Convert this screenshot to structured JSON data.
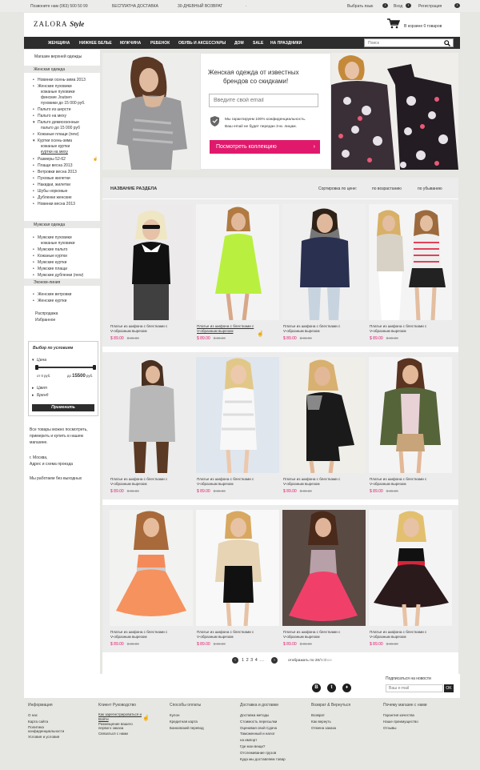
{
  "topbar": {
    "phone": "Позвоните нам (063) 500 50 99",
    "delivery": "БЕСПЛАТНА ДОСТАВКА",
    "return": "30-ДНЕВНЫЙ ВОЗВРАТ",
    "dot": "·",
    "lang": "Выбрать язык",
    "login": "Вход",
    "register": "Регистрация"
  },
  "header": {
    "logo_main": "ZALORA",
    "logo_style": "Style",
    "cart_text": "В корзине 0 товаров"
  },
  "nav": {
    "items": [
      "ЖЕНЩИНА",
      "НИЖНЕЕ БЕЛЬЕ",
      "МУЖЧИНА",
      "РЕБЕНОК",
      "ОБУВЬ И АКСЕССУАРЫ",
      "ДОМ",
      "SALE",
      "НА ПРАЗДНИКИ"
    ],
    "search_placeholder": "Поиск"
  },
  "sidebar": {
    "top_link": "Магазин верхней одежды",
    "women_head": "Женская одежда",
    "women_items": [
      "Новинки осень-зима 2013",
      "Женские пуховики",
      "кожаные пуховики",
      "финские Joutsen",
      "пуховики до 15 000 руб.",
      "Пальто из шерсти",
      "Пальто на меху",
      "Пальто демисезонные",
      "пальто до 15 000 руб",
      "Кожаные плащи (new)",
      "Куртки осень-зима",
      "кожаные куртки",
      "куртки на меху",
      "Размеры 52-62",
      "Плащи весна 2013",
      "Ветровки весна 2013",
      "Пуховые жилетки",
      "Накидки, жилетки",
      "Шубы норковые",
      "Дубленки женские",
      "Новинки весна 2013"
    ],
    "men_head": "Мужская одежда",
    "men_items": [
      "Мужские пуховики",
      "кожаные пуховики",
      "Мужские пальто",
      "Кожаные куртки",
      "Мужские куртки",
      "Мужские плащи",
      "Мужские дубленки (new)"
    ],
    "econom_head": "Эконом-линия",
    "econom_items": [
      "Женские ветровки",
      "Женские куртки"
    ],
    "extra_links": [
      "Распродажа",
      "Избранное"
    ],
    "filter_title": "Выбор по условиям",
    "filter_price": "Цена",
    "filter_from": "от 0",
    "filter_from_unit": "руб.",
    "filter_to": "до",
    "filter_to_value": "15500",
    "filter_to_unit": "руб.",
    "filter_color": "Цвет",
    "filter_brand": "Бренд",
    "filter_apply": "Применить",
    "info_text_1": "Все товары можно посмотреть,",
    "info_text_2": "примерить и купить в нашем",
    "info_text_3": "магазине.",
    "address_1": "г. Москва,",
    "address_2": "Адрес и схема проезда",
    "hours": "Мы работаем без выходных"
  },
  "banner": {
    "headline_1": "Женская  одежда от известных",
    "headline_2": "брендов со скидками!",
    "email_placeholder": "Введите свой email",
    "privacy_1": "Мы гарантируем 100% конфиденциальность.",
    "privacy_2": "Ваш email не будет передан 3-м. лицам.",
    "cta": "Посмотреть коллекцию"
  },
  "section": {
    "title": "НАЗВАНИЕ РАЗДЕЛА",
    "sort_label": "Сортировка по цене:",
    "sort_asc": "по возрастанию",
    "sort_desc": "по убыванию"
  },
  "products": [
    {
      "desc1": "Платье из шифона с блестками с",
      "desc2": "V-образным вырезом",
      "price": "$ 89.00",
      "old": "$ 89.00"
    },
    {
      "desc1": "Платье из шифона с блестками с",
      "desc2": "V-образным вырезом",
      "price": "$ 89.00",
      "old": "$ 89.00"
    },
    {
      "desc1": "Платье из шифона с блестками с",
      "desc2": "V-образным вырезом",
      "price": "$ 89.00",
      "old": "$ 89.00"
    },
    {
      "desc1": "Платье из шифона с блестками с",
      "desc2": "V-образным вырезом",
      "price": "$ 89.00",
      "old": "$ 89.00"
    },
    {
      "desc1": "Платье из шифона с блестками с",
      "desc2": "V-образным вырезом",
      "price": "$ 89.00",
      "old": "$ 89.00"
    },
    {
      "desc1": "Платье из шифона с блестками с",
      "desc2": "V-образным вырезом",
      "price": "$ 89.00",
      "old": "$ 89.00"
    },
    {
      "desc1": "Платье из шифона с блестками с",
      "desc2": "V-образным вырезом",
      "price": "$ 89.00",
      "old": "$ 89.00"
    },
    {
      "desc1": "Платье из шифона с блестками с",
      "desc2": "V-образным вырезом",
      "price": "$ 89.00",
      "old": "$ 89.00"
    },
    {
      "desc1": "Платье из шифона с блестками с",
      "desc2": "V-образным вырезом",
      "price": "$ 89.00",
      "old": "$ 89.00"
    },
    {
      "desc1": "Платье из шифона с блестками с",
      "desc2": "V-образным вырезом",
      "price": "$ 89.00",
      "old": "$ 89.00"
    },
    {
      "desc1": "Платье из шифона с блестками с",
      "desc2": "V-образным вырезом",
      "price": "$ 89.00",
      "old": "$ 89.00"
    },
    {
      "desc1": "Платье из шифона с блестками с",
      "desc2": "V-образным вырезом",
      "price": "$ 89.00",
      "old": "$ 89.00"
    }
  ],
  "pagination": {
    "pages": "1 2 3 4 ...",
    "show_label": "отображать по",
    "opt1": "20",
    "sep1": "/",
    "opt2": "50",
    "sep2": "/",
    "opt3": "все"
  },
  "newsletter": {
    "title": "Подписаться на новости",
    "placeholder": "Ваш e-mail",
    "ok": "OK"
  },
  "footer": {
    "cols": [
      {
        "h": "Информация",
        "l": [
          "О нас",
          "Карта сайта",
          "Политика",
          "конфиденциальности",
          "Условия и условия"
        ]
      },
      {
        "h": "Клиент Руководство",
        "l": [
          "Как зарегистрироваться и",
          "Войти",
          "Размещение вашего",
          "первого заказа",
          "Связаться с нами"
        ]
      },
      {
        "h": "Способы оплаты",
        "l": [
          "Кулон",
          "Кредитная карта",
          "Банковский перевод"
        ]
      },
      {
        "h": "Доставка и доставки",
        "l": [
          "Доставка методы",
          "Стоимость пересылки",
          "Оценивая свой Сдача",
          "Таможенный и налог",
          "на импорт",
          "Где мои вещи?",
          "Отслеживание грузов",
          "Куда мы доставляем товар"
        ]
      },
      {
        "h": "Возврат & Вернуться",
        "l": [
          "Возврат",
          "Как вернуть",
          "Отмена заказа"
        ]
      },
      {
        "h": "Почему магазин с нами",
        "l": [
          "Гарантия качества",
          "Наше преимущество",
          "Отзывы"
        ]
      }
    ]
  },
  "colors": {
    "accent": "#e0196c",
    "nav_bg": "#2d2d2d",
    "page_bg": "#e6e6e3"
  }
}
